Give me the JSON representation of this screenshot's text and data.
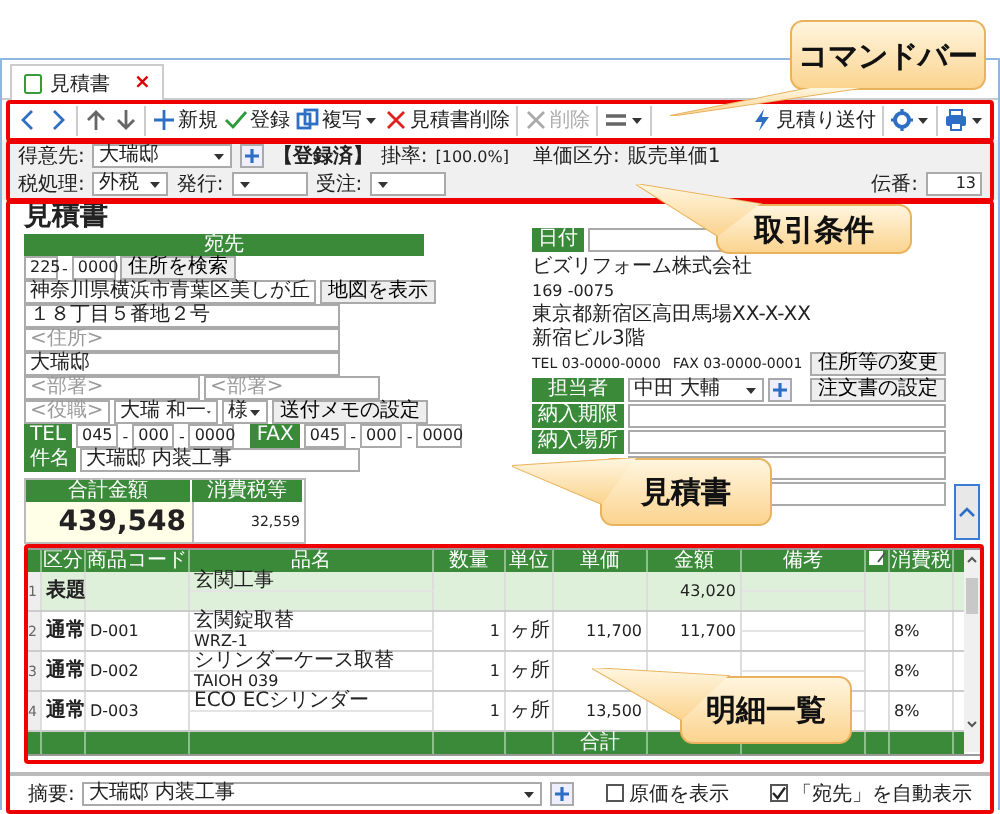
{
  "tab": {
    "label": "見積書",
    "close": "×"
  },
  "toolbar": {
    "groups": [
      [
        {
          "kind": "back",
          "disabled": false,
          "dropdown": false
        },
        {
          "kind": "forward",
          "disabled": false,
          "dropdown": false
        }
      ],
      [
        {
          "kind": "up",
          "disabled": false,
          "dropdown": false
        },
        {
          "kind": "down",
          "disabled": false,
          "dropdown": false
        }
      ],
      [
        {
          "kind": "new",
          "label": "新規",
          "disabled": false,
          "dropdown": false
        },
        {
          "kind": "save",
          "label": "登録",
          "disabled": false,
          "dropdown": false
        },
        {
          "kind": "copy",
          "label": "複写",
          "disabled": false,
          "dropdown": true
        },
        {
          "kind": "delete",
          "label": "見積書削除",
          "disabled": false,
          "dropdown": false
        }
      ],
      [
        {
          "kind": "remove",
          "label": "削除",
          "disabled": true,
          "dropdown": false
        }
      ],
      [
        {
          "kind": "rows",
          "disabled": false,
          "dropdown": true
        }
      ]
    ],
    "right_groups": [
      [
        {
          "kind": "send",
          "label": "見積り送付",
          "disabled": false,
          "dropdown": false
        }
      ],
      [
        {
          "kind": "settings",
          "disabled": false,
          "dropdown": true
        }
      ],
      [
        {
          "kind": "print",
          "disabled": false,
          "dropdown": true
        }
      ]
    ]
  },
  "conditions": {
    "customer": {
      "label": "得意先:",
      "value": "大瑞邸"
    },
    "status": "【登録済】",
    "rate": {
      "label": "掛率:",
      "value": "[100.0%]"
    },
    "price_class": {
      "label": "単価区分:",
      "value": "販売単価1"
    },
    "tax": {
      "label": "税処理:",
      "value": "外税"
    },
    "issue": {
      "label": "発行:"
    },
    "order": {
      "label": "受注:"
    },
    "slip": {
      "label": "伝番:",
      "value": "13"
    }
  },
  "estimate": {
    "title": "見積書",
    "recipient": {
      "header": "宛先",
      "separator": "-",
      "zip1": "225",
      "zip2": "0000",
      "search_button": "住所を検索",
      "address1": "神奈川県横浜市青葉区美しが丘",
      "map_button": "地図を表示",
      "address2": "１８丁目５番地２号",
      "address3_placeholder": "<住所>",
      "company": "大瑞邸",
      "dept1_placeholder": "<部署>",
      "dept2_placeholder": "<部署>",
      "position_placeholder": "<役職>",
      "person": "大瑞 和一",
      "honorific": "様",
      "memo_button": "送付メモの設定",
      "tel_label": "TEL",
      "tel": [
        "045",
        "000",
        "0000"
      ],
      "fax_label": "FAX",
      "fax": [
        "045",
        "000",
        "0000"
      ]
    },
    "subject": {
      "label": "件名",
      "value": "大瑞邸 内装工事"
    },
    "totals": {
      "amount_label": "合計金額",
      "amount": "439,548",
      "tax_label": "消費税等",
      "tax": "32,559"
    }
  },
  "issuer": {
    "date_label": "日付",
    "company": "ビズリフォーム株式会社",
    "zip": "169 -0075",
    "address": "東京都新宿区高田馬場XX-X-XX",
    "building": "新宿ビル3階",
    "tel": "TEL 03-0000-0000",
    "fax": "FAX 03-0000-0001",
    "change_button": "住所等の変更",
    "staff_label": "担当者",
    "staff": "中田 大輔",
    "order_button": "注文書の設定",
    "fields": [
      {
        "label": "納入期限"
      },
      {
        "label": "納入場所"
      }
    ]
  },
  "items": {
    "columns": [
      {
        "kind": "number"
      },
      {
        "kind": "text",
        "label": "区分"
      },
      {
        "kind": "text",
        "label": "商品コード"
      },
      {
        "kind": "text",
        "label": "品名"
      },
      {
        "kind": "text",
        "label": "数量"
      },
      {
        "kind": "text",
        "label": "単位"
      },
      {
        "kind": "text",
        "label": "単価"
      },
      {
        "kind": "text",
        "label": "金額"
      },
      {
        "kind": "text",
        "label": "備考"
      },
      {
        "kind": "memo"
      },
      {
        "kind": "text",
        "label": "消費税"
      }
    ],
    "rows": [
      {
        "number": "1",
        "kind": "heading",
        "category": "表題",
        "name": "玄関工事",
        "amount": "43,020"
      },
      {
        "number": "2",
        "kind": "item",
        "category": "通常",
        "code": "D-001",
        "name": "玄関錠取替",
        "spec": "WRZ-1",
        "qty": "1",
        "unit": "ヶ所",
        "price": "11,700",
        "amount": "11,700",
        "tax": "8%"
      },
      {
        "number": "3",
        "kind": "item",
        "category": "通常",
        "code": "D-002",
        "name": "シリンダーケース取替",
        "spec": "TAIOH 039",
        "qty": "1",
        "unit": "ヶ所",
        "tax": "8%"
      },
      {
        "number": "4",
        "kind": "item",
        "category": "通常",
        "code": "D-003",
        "name": "ECO ECシリンダー",
        "qty": "1",
        "unit": "ヶ所",
        "price": "13,500",
        "tax": "8%"
      }
    ],
    "footer_label": "合計"
  },
  "bottom": {
    "summary_label": "摘要:",
    "summary": "大瑞邸 内装工事",
    "show_cost": {
      "label": "原価を表示",
      "checked": false
    },
    "auto_recipient": {
      "label": "「宛先」を自動表示",
      "checked": true
    }
  },
  "callouts": [
    {
      "text": "コマンドバー"
    },
    {
      "text": "取引条件"
    },
    {
      "text": "見積書"
    },
    {
      "text": "明細一覧"
    }
  ]
}
